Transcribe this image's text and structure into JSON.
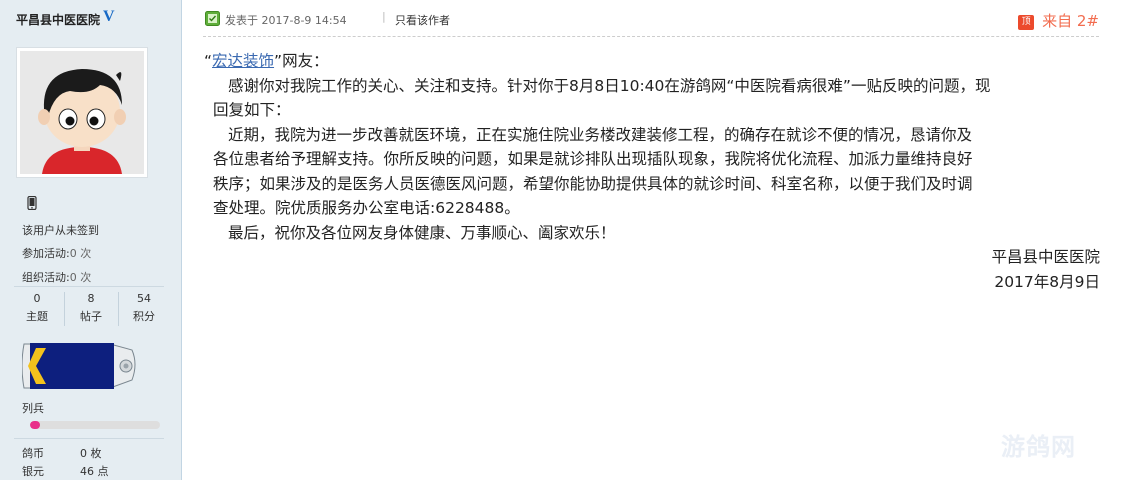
{
  "author": {
    "username": "平昌县中医医院",
    "verified_badge": "V",
    "checkin_status": "该用户从未签到",
    "stats_lines": [
      {
        "label": "参加活动:",
        "value": "0 次"
      },
      {
        "label": "组织活动:",
        "value": "0 次"
      }
    ],
    "counts": [
      {
        "value": "0",
        "label": "主题"
      },
      {
        "value": "8",
        "label": "帖子"
      },
      {
        "value": "54",
        "label": "积分"
      }
    ],
    "rank": "列兵",
    "rank_progress": 0.08,
    "currencies": [
      {
        "label": "鸽币",
        "value": "0 枚"
      },
      {
        "label": "银元",
        "value": "46 点"
      }
    ]
  },
  "post": {
    "posted_at": "发表于 2017-8-9 14:54",
    "separator": "|",
    "only_author": "只看该作者",
    "floor_icon": "顶",
    "floor_label": "来自 2#",
    "quote_open": "“",
    "addressee_link": "宏达装饰",
    "addressee_suffix": "”网友：",
    "paragraphs": [
      "感谢你对我院工作的关心、关注和支持。针对你于8月8日10:40在游鸽网“中医院看病很难”一贴反映的问题，现",
      "回复如下：",
      "近期，我院为进一步改善就医环境，正在实施住院业务楼改建装修工程，的确存在就诊不便的情况，恳请你及",
      "各位患者给予理解支持。你所反映的问题，如果是就诊排队出现插队现象，我院将优化流程、加派力量维持良好",
      "秩序；如果涉及的是医务人员医德医风问题，希望你能协助提供具体的就诊时间、科室名称，以便于我们及时调",
      "查处理。院优质服务办公室电话:6228488。",
      "最后，祝你及各位网友身体健康、万事顺心、阖家欢乐！"
    ],
    "signature": "平昌县中医医院",
    "date": "2017年8月9日",
    "watermark": "游鸽网"
  },
  "colors": {
    "sidebar_bg": "#e5edf2",
    "link": "#3a69b1",
    "floor": "#f26c4f",
    "verified": "#1769c5",
    "progress": "#e8308a"
  }
}
